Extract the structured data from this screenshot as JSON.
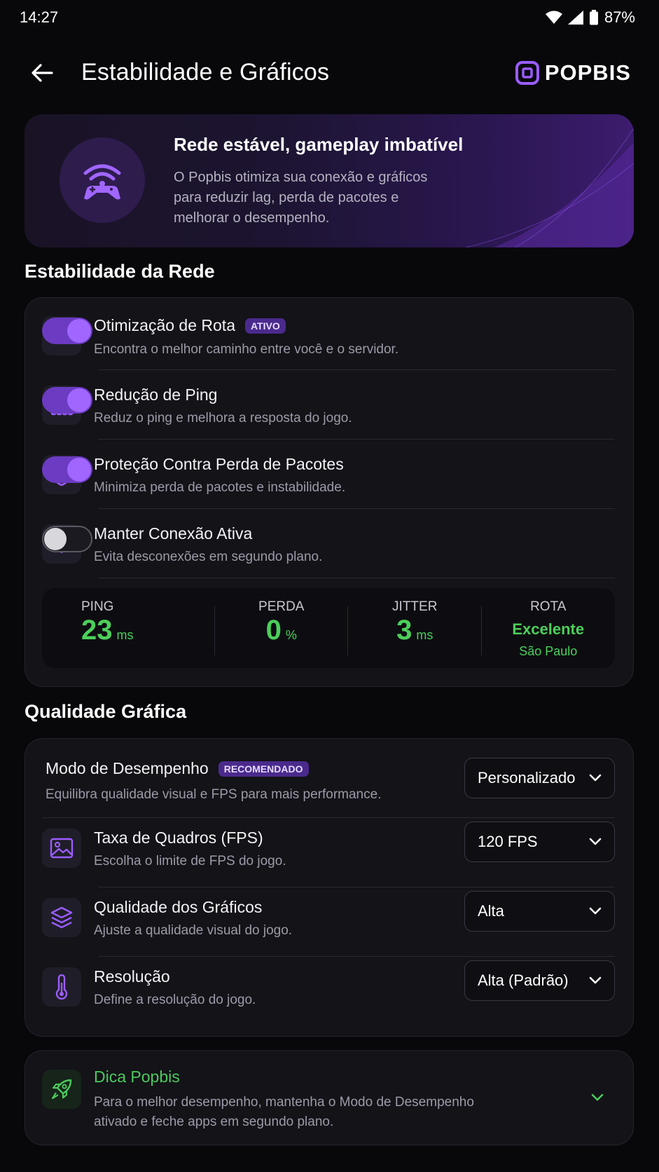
{
  "status_bar": {
    "time": "14:27",
    "battery": "87%"
  },
  "header": {
    "title": "Estabilidade e Gráficos",
    "logo_text": "POPBIS"
  },
  "hero": {
    "title": "Rede estável, gameplay imbatível",
    "description": "O Popbis otimiza sua conexão e gráficos para reduzir lag, perda de pacotes e melhorar o desempenho."
  },
  "network": {
    "section_title": "Estabilidade da Rede",
    "items": [
      {
        "title": "Otimização de Rota",
        "badge": "ATIVO",
        "subtitle": "Encontra o melhor caminho entre você e o servidor.",
        "enabled": true,
        "icon": "speedometer-icon"
      },
      {
        "title": "Redução de Ping",
        "subtitle": "Reduz o ping e melhora a resposta do jogo.",
        "enabled": true,
        "icon": "bar-chart-icon"
      },
      {
        "title": "Proteção Contra Perda de Pacotes",
        "subtitle": "Minimiza perda de pacotes e instabilidade.",
        "enabled": true,
        "icon": "shield-icon"
      },
      {
        "title": "Manter Conexão Ativa",
        "subtitle": "Evita desconexões em segundo plano.",
        "enabled": false,
        "icon": "wifi-icon"
      }
    ],
    "stats": {
      "ping": {
        "label": "PING",
        "value": "23",
        "unit": "ms"
      },
      "loss": {
        "label": "PERDA",
        "value": "0",
        "unit": "%"
      },
      "jitter": {
        "label": "JITTER",
        "value": "3",
        "unit": "ms"
      },
      "route": {
        "label": "ROTA",
        "value": "Excelente",
        "location": "São Paulo"
      }
    }
  },
  "graphics": {
    "section_title": "Qualidade Gráfica",
    "mode": {
      "title": "Modo de Desempenho",
      "badge": "RECOMENDADO",
      "subtitle": "Equilibra qualidade visual e FPS para mais performance.",
      "selected": "Personalizado"
    },
    "items": [
      {
        "title": "Taxa de Quadros (FPS)",
        "subtitle": "Escolha o limite de FPS do jogo.",
        "selected": "120 FPS",
        "icon": "image-icon"
      },
      {
        "title": "Qualidade dos Gráficos",
        "subtitle": "Ajuste a qualidade visual do jogo.",
        "selected": "Alta",
        "icon": "layers-icon"
      },
      {
        "title": "Resolução",
        "subtitle": "Define a resolução do jogo.",
        "selected": "Alta (Padrão)",
        "icon": "thermometer-icon"
      }
    ]
  },
  "tip": {
    "title": "Dica Popbis",
    "text": "Para o melhor desempenho, mantenha o Modo de Desempenho ativado e feche apps em segundo plano."
  },
  "colors": {
    "accent": "#9b5cff",
    "success": "#4ccf5a",
    "background": "#08080b",
    "card": "#131318"
  }
}
